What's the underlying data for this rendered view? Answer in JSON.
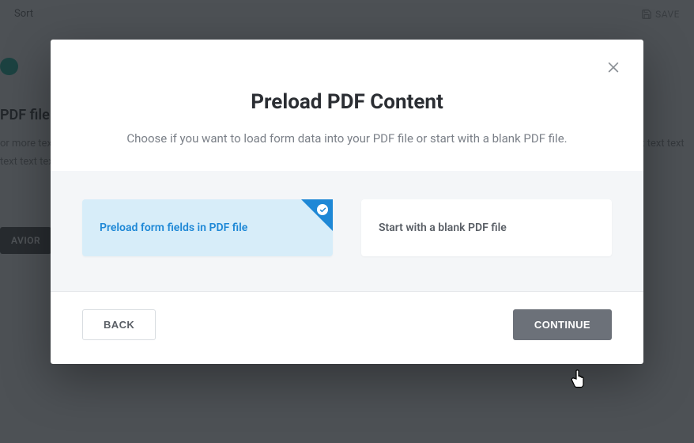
{
  "bg": {
    "top_left": "Sort",
    "top_right": "SAVE",
    "heading": "PDF file",
    "para": "or more text text text text text text text text text text text text text text text text text text text text text text text text all here that will text text text text text text text text text text text text text text text text text text text text text text text ated with missions",
    "behavior_btn": "AVIOR"
  },
  "modal": {
    "title": "Preload PDF Content",
    "subtitle": "Choose if you want to load form data into your PDF file or start with a blank PDF file.",
    "option_preload": "Preload form fields in PDF file",
    "option_blank": "Start with a blank PDF file",
    "back": "BACK",
    "continue": "CONTINUE"
  }
}
